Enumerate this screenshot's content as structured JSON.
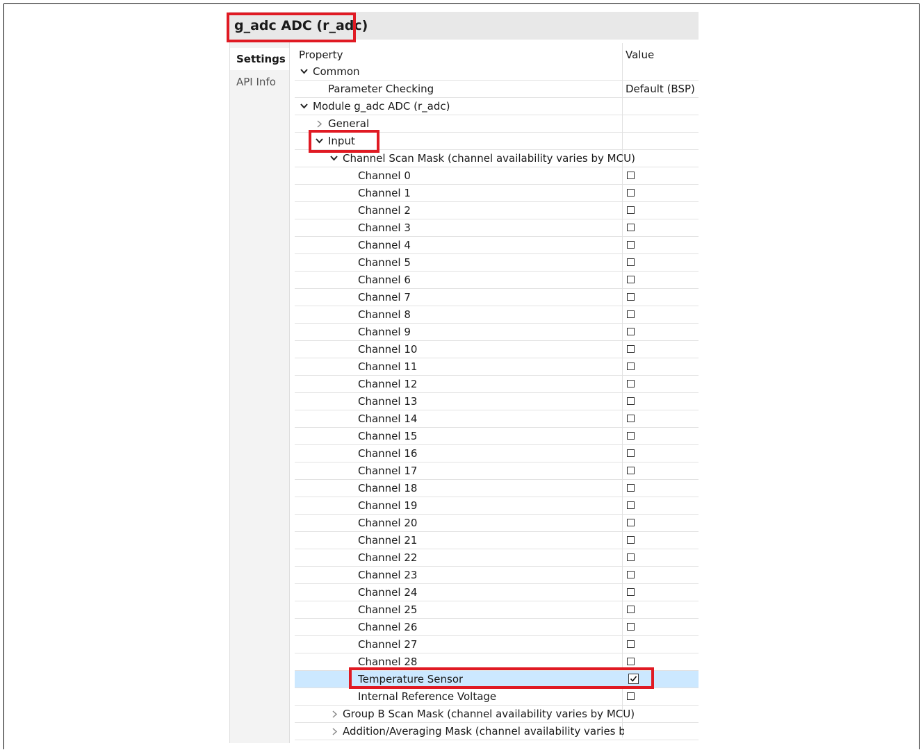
{
  "title": "g_adc ADC (r_adc)",
  "tabs": [
    {
      "label": "Settings"
    },
    {
      "label": "API Info"
    }
  ],
  "columns": {
    "property": "Property",
    "value": "Value"
  },
  "rows": {
    "common": "Common",
    "parameter_checking": {
      "label": "Parameter Checking",
      "value": "Default (BSP)"
    },
    "module": "Module g_adc ADC (r_adc)",
    "general": "General",
    "input": "Input",
    "scan_mask": "Channel Scan Mask (channel availability varies by MCU)",
    "channels": [
      "Channel 0",
      "Channel 1",
      "Channel 2",
      "Channel 3",
      "Channel 4",
      "Channel 5",
      "Channel 6",
      "Channel 7",
      "Channel 8",
      "Channel 9",
      "Channel 10",
      "Channel 11",
      "Channel 12",
      "Channel 13",
      "Channel 14",
      "Channel 15",
      "Channel 16",
      "Channel 17",
      "Channel 18",
      "Channel 19",
      "Channel 20",
      "Channel 21",
      "Channel 22",
      "Channel 23",
      "Channel 24",
      "Channel 25",
      "Channel 26",
      "Channel 27",
      "Channel 28"
    ],
    "temperature_sensor": {
      "label": "Temperature Sensor",
      "checked": true
    },
    "internal_reference": {
      "label": "Internal Reference Voltage",
      "checked": false
    },
    "group_b": "Group B Scan Mask (channel availability varies by MCU)",
    "addition": "Addition/Averaging Mask (channel availability varies by M"
  },
  "icons": {
    "expanded": "chevron-down-icon",
    "collapsed": "chevron-right-icon",
    "checkbox": "checkbox-icon"
  },
  "colors": {
    "highlight": "#e01a23",
    "selection": "#cce8ff",
    "header_bg": "#e8e8e8"
  }
}
